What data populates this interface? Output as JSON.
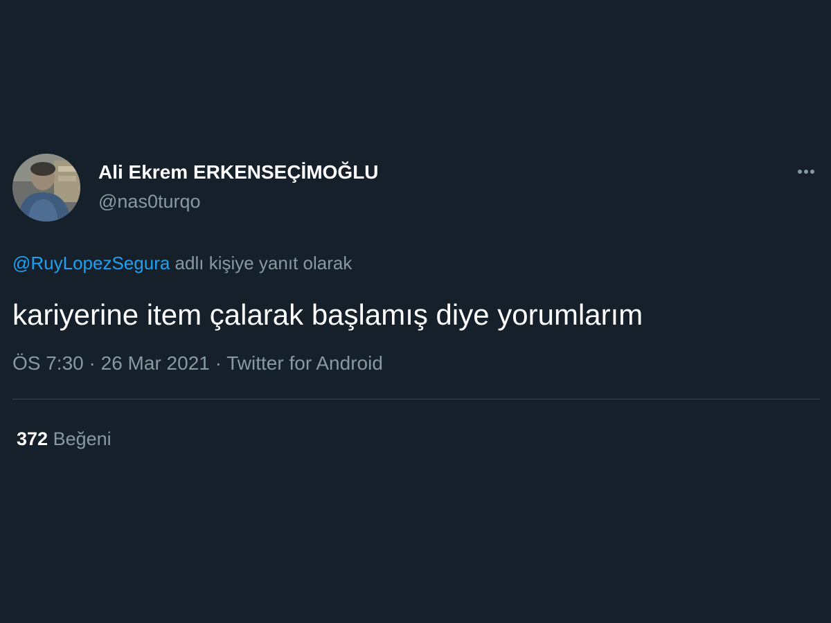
{
  "tweet": {
    "author": {
      "display_name": "Ali Ekrem ERKENSEÇİMOĞLU",
      "handle": "@nas0turqo",
      "avatar_icon": "person-photo-avatar"
    },
    "more_icon": "more-horizontal-icon",
    "reply": {
      "mention": "@RuyLopezSegura",
      "suffix": "adlı kişiye yanıt olarak"
    },
    "text": "kariyerine item çalarak başlamış diye yorumlarım",
    "meta": {
      "time": "ÖS 7:30",
      "separator": "·",
      "date": "26 Mar 2021",
      "source": "Twitter for Android"
    },
    "stats": {
      "likes_count": "372",
      "likes_label": "Beğeni"
    }
  },
  "colors": {
    "background": "#15202b",
    "primary_text": "#ffffff",
    "secondary_text": "#8899a6",
    "accent": "#1da1f2",
    "divider": "#38444d"
  }
}
